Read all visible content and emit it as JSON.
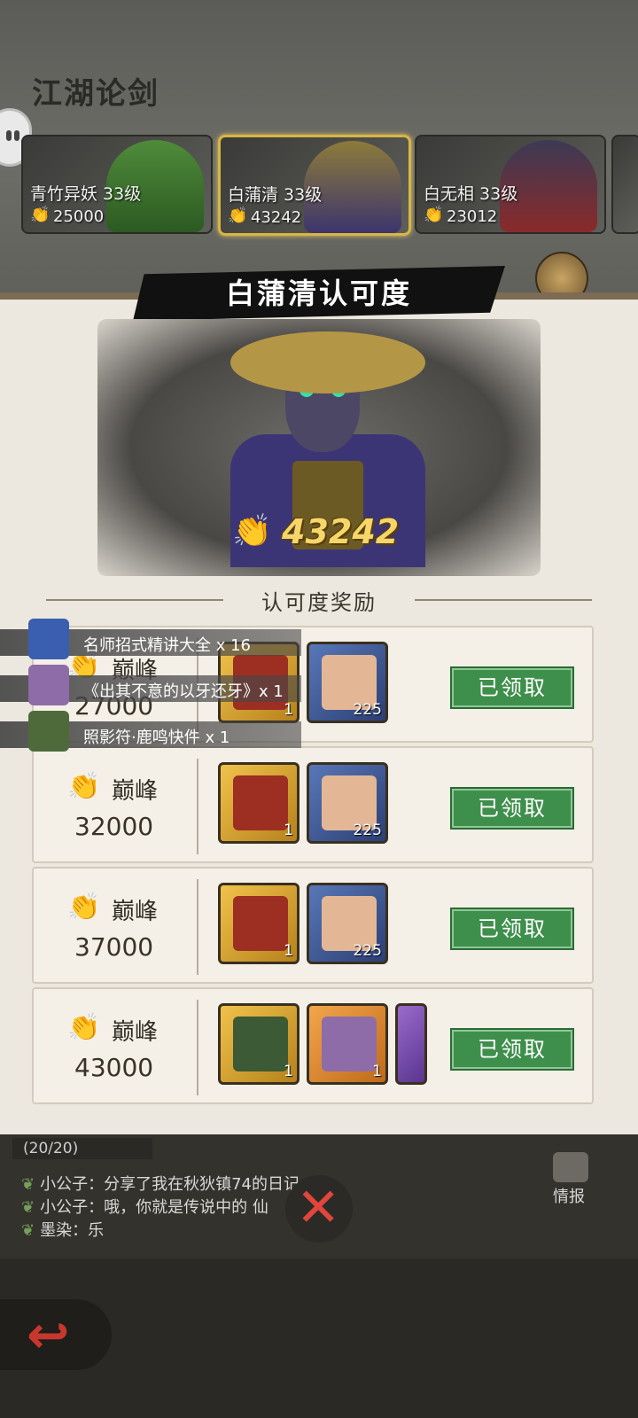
{
  "screen_title": "江湖论剑",
  "bosses": [
    {
      "name": "青竹异妖 33级",
      "score": "25000"
    },
    {
      "name": "白蒲清 33级",
      "score": "43242"
    },
    {
      "name": "白无相 33级",
      "score": "23012"
    }
  ],
  "banner_title": "白蒲清认可度",
  "current_score": "43242",
  "section_title": "认可度奖励",
  "rows": [
    {
      "tier": "巅峰",
      "threshold": "27000",
      "items": [
        {
          "count": "1"
        },
        {
          "count": "225"
        }
      ],
      "button": "已领取"
    },
    {
      "tier": "巅峰",
      "threshold": "32000",
      "items": [
        {
          "count": "1"
        },
        {
          "count": "225"
        }
      ],
      "button": "已领取"
    },
    {
      "tier": "巅峰",
      "threshold": "37000",
      "items": [
        {
          "count": "1"
        },
        {
          "count": "225"
        }
      ],
      "button": "已领取"
    },
    {
      "tier": "巅峰",
      "threshold": "43000",
      "items": [
        {
          "count": "1"
        },
        {
          "count": "1"
        }
      ],
      "button": "已领取"
    }
  ],
  "notices": [
    {
      "text": "名师招式精讲大全 x 16",
      "icon": "blue-book-icon"
    },
    {
      "text": "《出其不意的以牙还牙》x 1",
      "icon": "purple-book-icon"
    },
    {
      "text": "照影符·鹿鸣快件 x 1",
      "icon": "green-talisman-icon"
    }
  ],
  "chat": {
    "count": "(20/20)",
    "lines": [
      "小公子：分享了我在秋狄镇74的日记...",
      "小公子：哦，你就是传说中的 仙",
      "墨染：乐"
    ]
  },
  "intel_label": "情报",
  "colors": {
    "claimed_button": "#3f8f4c",
    "score_gold": "#f5d66a",
    "panel": "#ece8df"
  }
}
